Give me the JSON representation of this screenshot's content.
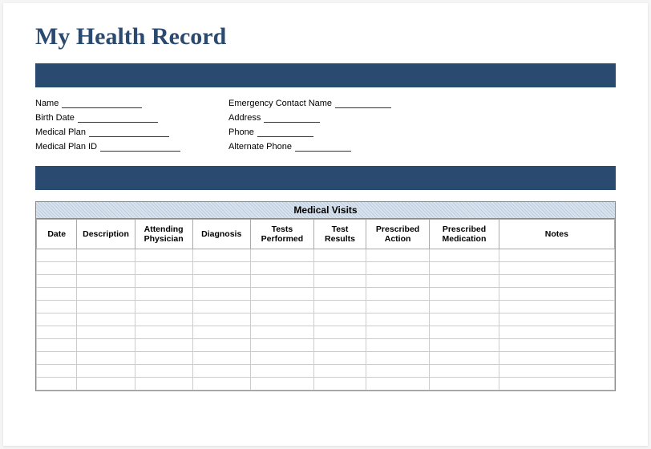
{
  "title": "My Health Record",
  "info_left": {
    "name": "Name",
    "birth_date": "Birth Date",
    "medical_plan": "Medical Plan",
    "medical_plan_id": "Medical Plan ID"
  },
  "info_right": {
    "emergency_contact": "Emergency Contact Name",
    "address": "Address",
    "phone": "Phone",
    "alternate_phone": "Alternate Phone"
  },
  "table": {
    "title": "Medical Visits",
    "columns": {
      "date": "Date",
      "description": "Description",
      "physician": "Attending Physician",
      "diagnosis": "Diagnosis",
      "tests_performed": "Tests Performed",
      "test_results": "Test Results",
      "prescribed_action": "Prescribed Action",
      "prescribed_medication": "Prescribed Medication",
      "notes": "Notes"
    },
    "row_count": 11
  }
}
